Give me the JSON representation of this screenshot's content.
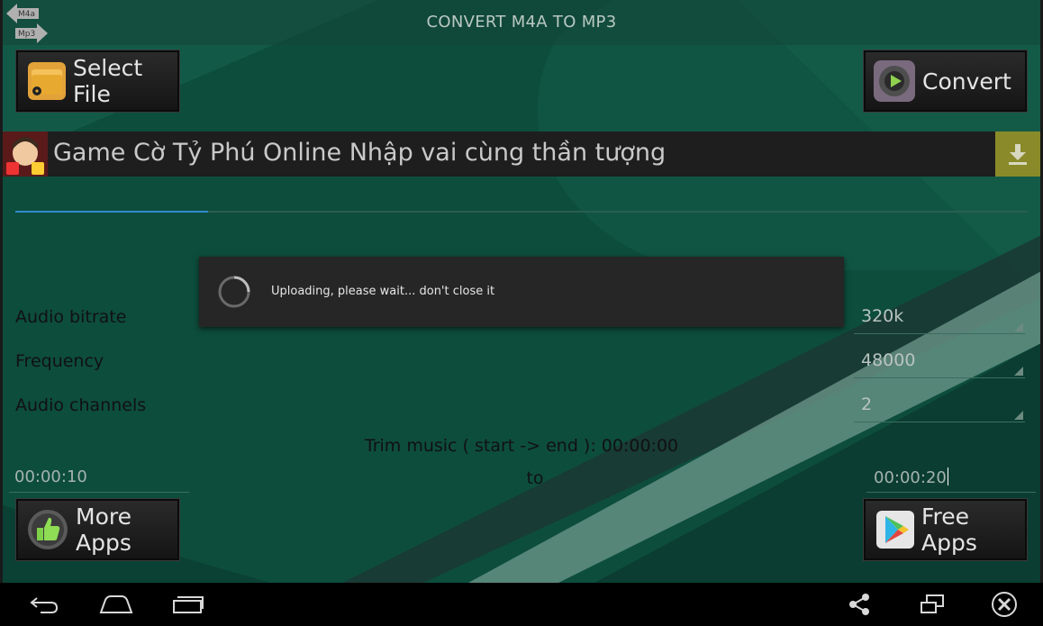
{
  "app": {
    "title": "CONVERT M4A TO MP3",
    "icon_labels": {
      "top": "M4a",
      "bottom": "Mp3"
    }
  },
  "toolbar": {
    "select_file_label": "Select File",
    "convert_label": "Convert"
  },
  "ad": {
    "text": "Game Cờ Tỷ Phú Online Nhập vai cùng thần tượng",
    "icon": "download-icon"
  },
  "progress": {
    "fraction": 0.19
  },
  "settings": {
    "bitrate_label": "Audio bitrate",
    "bitrate_value": "320k",
    "frequency_label": "Frequency",
    "frequency_value": "48000",
    "channels_label": "Audio channels",
    "channels_value": "2"
  },
  "trim": {
    "summary": "Trim music ( start -> end ): 00:00:00",
    "start": "00:00:10",
    "separator": "to",
    "end": "00:00:20"
  },
  "bottom_buttons": {
    "more_apps_label": "More Apps",
    "free_apps_label": "Free Apps"
  },
  "dialog": {
    "message": "Uploading, please wait... don't close it"
  },
  "nav": {
    "icons": [
      "back-icon",
      "home-icon",
      "recent-apps-icon",
      "share-icon",
      "window-icon",
      "close-icon"
    ]
  },
  "colors": {
    "background": "#0c4a3a",
    "progress": "#2e8bd0",
    "dialog": "#262626",
    "ad_download": "#8a8a2a"
  }
}
